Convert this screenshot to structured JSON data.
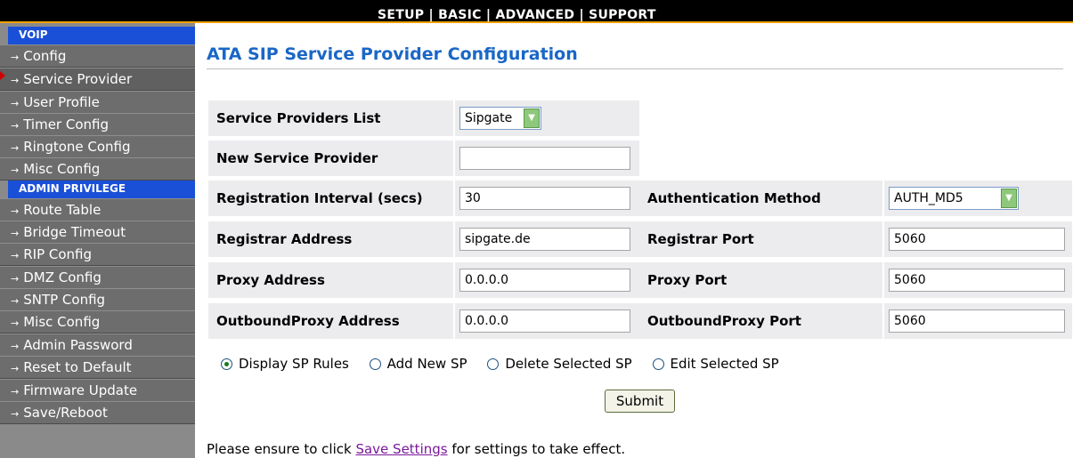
{
  "topnav": {
    "items": [
      "SETUP",
      "BASIC",
      "ADVANCED",
      "SUPPORT"
    ],
    "separator": "|"
  },
  "sidebar": {
    "voip_header": "VOIP",
    "voip_items": [
      "Config",
      "Service Provider",
      "User Profile",
      "Timer Config",
      "Ringtone Config",
      "Misc Config"
    ],
    "admin_header": "ADMIN PRIVILEGE",
    "admin_items": [
      "Route Table",
      "Bridge Timeout",
      "RIP Config",
      "DMZ Config",
      "SNTP Config",
      "Misc Config",
      "Admin Password",
      "Reset to Default",
      "Firmware Update",
      "Save/Reboot"
    ],
    "arrow": "→"
  },
  "main": {
    "title": "ATA SIP Service Provider Configuration",
    "service_providers_list": {
      "label": "Service Providers List",
      "value": "Sipgate"
    },
    "new_service_provider": {
      "label": "New Service Provider",
      "value": ""
    },
    "registration_interval": {
      "label": "Registration Interval (secs)",
      "value": "30"
    },
    "authentication_method": {
      "label": "Authentication Method",
      "value": "AUTH_MD5"
    },
    "registrar_address": {
      "label": "Registrar Address",
      "value": "sipgate.de"
    },
    "registrar_port": {
      "label": "Registrar Port",
      "value": "5060"
    },
    "proxy_address": {
      "label": "Proxy Address",
      "value": "0.0.0.0"
    },
    "proxy_port": {
      "label": "Proxy Port",
      "value": "5060"
    },
    "outbound_proxy_address": {
      "label": "OutboundProxy Address",
      "value": "0.0.0.0"
    },
    "outbound_proxy_port": {
      "label": "OutboundProxy Port",
      "value": "5060"
    },
    "radios": [
      {
        "label": "Display SP Rules",
        "checked": true
      },
      {
        "label": "Add New SP",
        "checked": false
      },
      {
        "label": "Delete Selected SP",
        "checked": false
      },
      {
        "label": "Edit Selected SP",
        "checked": false
      }
    ],
    "submit_label": "Submit",
    "notice_prefix": "Please ensure to click",
    "notice_link": "Save Settings",
    "notice_suffix": "for settings to take effect."
  },
  "colors": {
    "title_blue": "#1a67c6",
    "sidebar_header_blue": "#1a50d8",
    "topbar_accent": "#f0a000"
  }
}
